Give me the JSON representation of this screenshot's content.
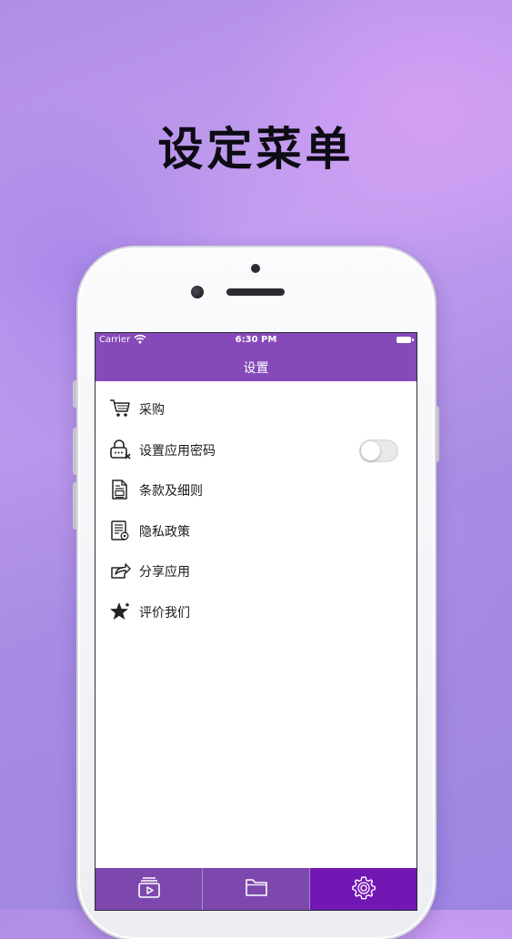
{
  "headline": "设定菜单",
  "status_bar": {
    "carrier": "Carrier",
    "time": "6:30 PM",
    "wifi_icon": "wifi-icon",
    "battery_icon": "battery-icon"
  },
  "nav": {
    "title": "设置"
  },
  "menu": {
    "items": [
      {
        "label": "采购",
        "icon": "shopping-cart-icon"
      },
      {
        "label": "设置应用密码",
        "icon": "lock-icon"
      },
      {
        "label": "条款及细则",
        "icon": "document-icon"
      },
      {
        "label": "隐私政策",
        "icon": "privacy-document-icon"
      },
      {
        "label": "分享应用",
        "icon": "share-icon"
      },
      {
        "label": "评价我们",
        "icon": "star-icon"
      }
    ],
    "passcode_toggle_on": false
  },
  "tabbar": {
    "tabs": [
      {
        "icon": "video-icon"
      },
      {
        "icon": "folder-icon"
      },
      {
        "icon": "gear-icon",
        "selected": true
      }
    ]
  },
  "colors": {
    "accent": "#8649b9",
    "selected_tab": "#7217b4",
    "background": "#b08ee6"
  }
}
